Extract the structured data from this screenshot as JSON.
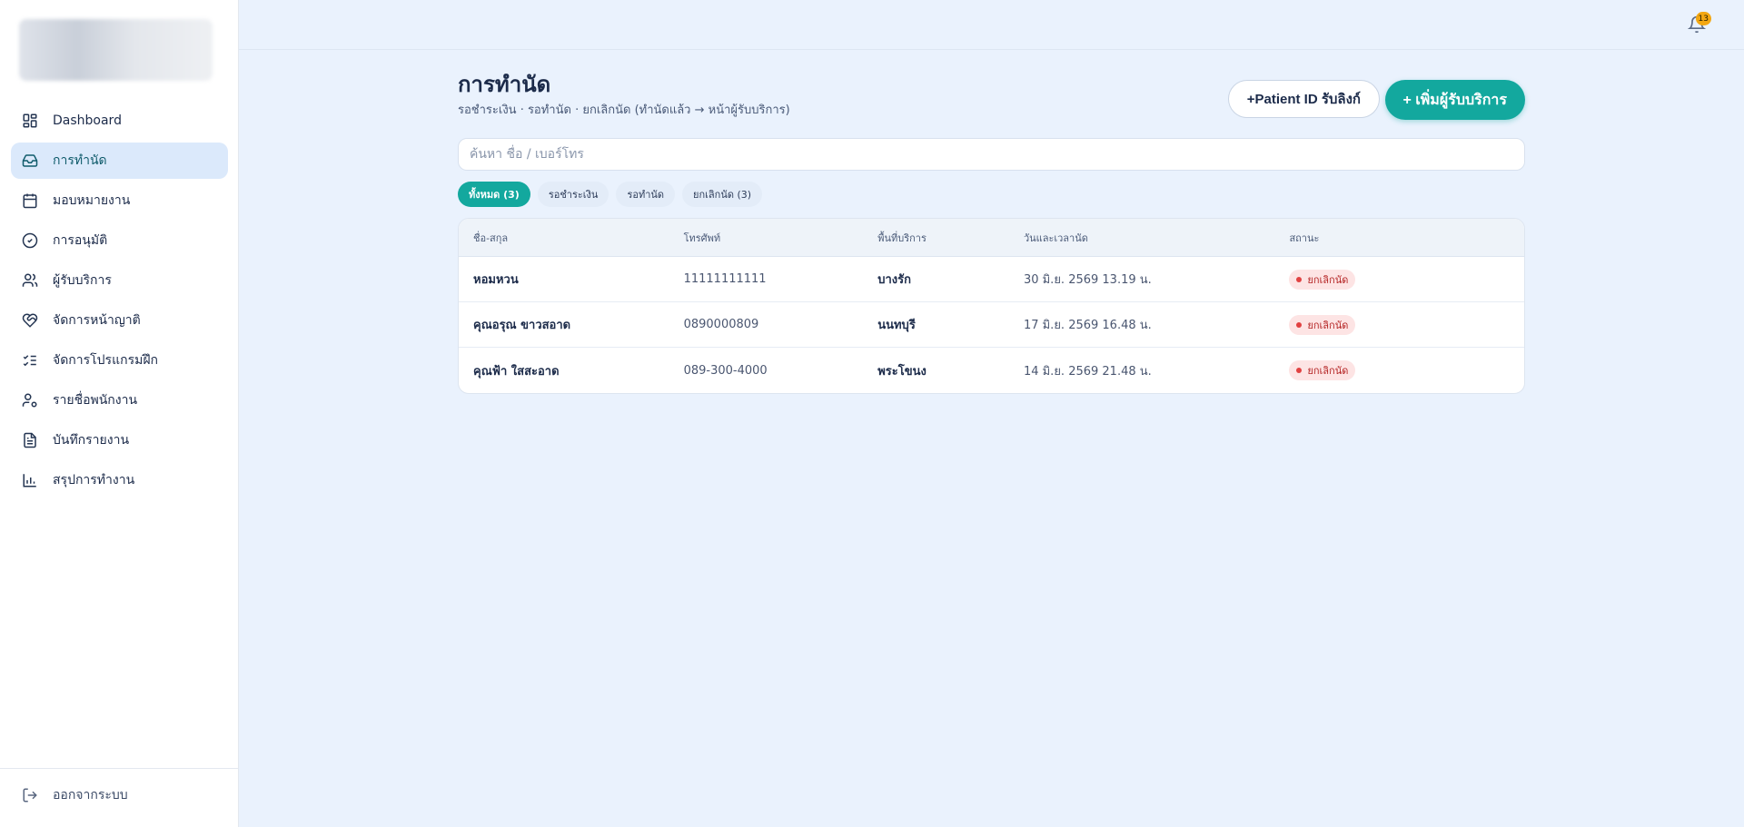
{
  "sidebar": {
    "items": [
      {
        "label": "Dashboard",
        "icon": "dashboard-icon"
      },
      {
        "label": "การทำนัด",
        "icon": "inbox-icon"
      },
      {
        "label": "มอบหมายงาน",
        "icon": "calendar-icon"
      },
      {
        "label": "การอนุมัติ",
        "icon": "check-circle-icon"
      },
      {
        "label": "ผู้รับบริการ",
        "icon": "users-icon"
      },
      {
        "label": "จัดการหน้าญาติ",
        "icon": "heart-handshake-icon"
      },
      {
        "label": "จัดการโปรแกรมฝึก",
        "icon": "list-checks-icon"
      },
      {
        "label": "รายชื่อพนักงาน",
        "icon": "user-cog-icon"
      },
      {
        "label": "บันทึกรายงาน",
        "icon": "file-text-icon"
      },
      {
        "label": "สรุปการทำงาน",
        "icon": "bar-chart-icon"
      }
    ],
    "active_index": 1,
    "logout_label": "ออกจากระบบ"
  },
  "topbar": {
    "notification_count": "13"
  },
  "page": {
    "title": "การทำนัด",
    "subtitle": "รอชำระเงิน · รอทำนัด · ยกเลิกนัด (ทำนัดแล้ว → หน้าผู้รับบริการ)",
    "link_button_label": "+Patient ID รับลิงก์",
    "add_button_label": "+ เพิ่มผู้รับบริการ"
  },
  "search": {
    "placeholder": "ค้นหา ชื่อ / เบอร์โทร",
    "value": ""
  },
  "filters": [
    {
      "label": "ทั้งหมด (3)",
      "active": true
    },
    {
      "label": "รอชำระเงิน",
      "active": false
    },
    {
      "label": "รอทำนัด",
      "active": false
    },
    {
      "label": "ยกเลิกนัด (3)",
      "active": false
    }
  ],
  "table": {
    "headers": [
      "ชื่อ-สกุล",
      "โทรศัพท์",
      "พื้นที่บริการ",
      "วันและเวลานัด",
      "สถานะ"
    ],
    "rows": [
      [
        "หอมหวน",
        "11111111111",
        "บางรัก",
        "30 มิ.ย. 2569 13.19 น.",
        "ยกเลิกนัด"
      ],
      [
        "คุณอรุณ ขาวสอาด",
        "0890000809",
        "นนทบุรี",
        "17 มิ.ย. 2569 16.48 น.",
        "ยกเลิกนัด"
      ],
      [
        "คุณฟ้า ใสสะอาด",
        "089-300-4000",
        "พระโขนง",
        "14 มิ.ย. 2569 21.48 น.",
        "ยกเลิกนัด"
      ]
    ]
  },
  "colors": {
    "accent": "#13a89e",
    "background": "#eaf2fd",
    "status_cancel_bg": "#fde4e4",
    "status_cancel_text": "#b42323",
    "badge": "#f3a712"
  }
}
